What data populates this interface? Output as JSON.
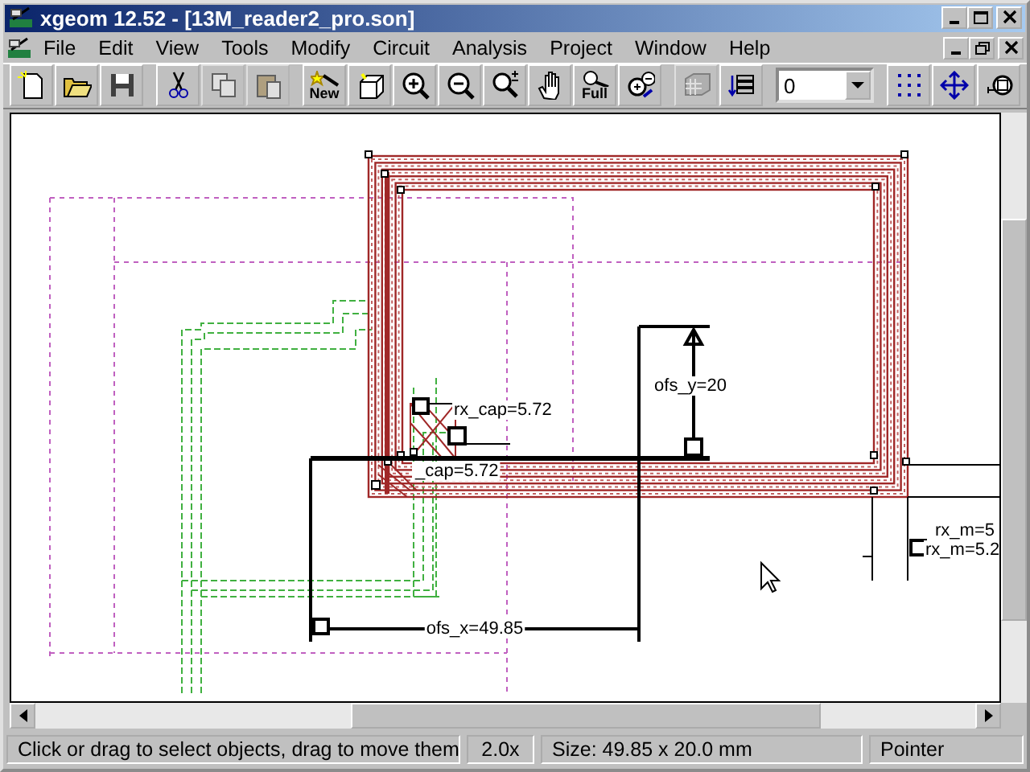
{
  "window": {
    "title": "xgeom 12.52 - [13M_reader2_pro.son]"
  },
  "menu": [
    {
      "label": "File"
    },
    {
      "label": "Edit"
    },
    {
      "label": "View"
    },
    {
      "label": "Tools"
    },
    {
      "label": "Modify"
    },
    {
      "label": "Circuit"
    },
    {
      "label": "Analysis"
    },
    {
      "label": "Project"
    },
    {
      "label": "Window"
    },
    {
      "label": "Help"
    }
  ],
  "toolbar": [
    [
      {
        "kind": "newfile",
        "disabled": false
      },
      {
        "kind": "open",
        "disabled": false
      },
      {
        "kind": "save",
        "disabled": false
      }
    ],
    [
      {
        "kind": "cut",
        "disabled": false
      },
      {
        "kind": "copy",
        "disabled": true
      },
      {
        "kind": "paste",
        "disabled": true
      }
    ],
    [
      {
        "kind": "newobj",
        "label": "New",
        "disabled": false
      },
      {
        "kind": "box",
        "disabled": false
      },
      {
        "kind": "zoomin",
        "disabled": false
      },
      {
        "kind": "zoomout",
        "disabled": false
      },
      {
        "kind": "zoomstep",
        "disabled": false
      },
      {
        "kind": "hand",
        "disabled": false
      },
      {
        "kind": "zoomfull",
        "label": "Full",
        "disabled": false
      },
      {
        "kind": "zoomfit",
        "disabled": false
      }
    ],
    [
      {
        "kind": "hatch",
        "disabled": true
      },
      {
        "kind": "layers",
        "disabled": false
      }
    ],
    [
      {
        "kind": "grid",
        "disabled": false
      },
      {
        "kind": "move",
        "disabled": false
      },
      {
        "kind": "measure",
        "disabled": false
      }
    ]
  ],
  "level_select": {
    "value": "0"
  },
  "canvas": {
    "labels": [
      {
        "text": "rx_cap=5.72"
      },
      {
        "text": "_cap=5.72"
      },
      {
        "text": "ofs_y=20"
      },
      {
        "text": "ofs_x=49.85"
      },
      {
        "text": "rx_m=5"
      },
      {
        "text": "rx_m=5.2"
      }
    ]
  },
  "status_bar": [
    {
      "text": "Click or drag to select objects, drag to move them"
    },
    {
      "text": "2.0x"
    },
    {
      "text": "Size: 49.85 x 20.0 mm"
    },
    {
      "text": "Pointer"
    }
  ]
}
